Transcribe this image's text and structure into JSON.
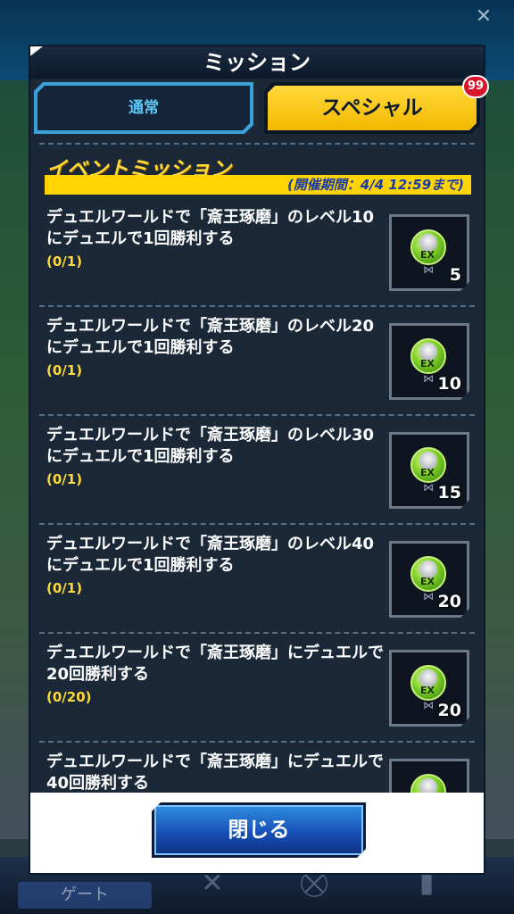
{
  "background": {
    "gate_label": "ゲート"
  },
  "modal": {
    "title": "ミッション",
    "tabs": [
      {
        "label": "通常",
        "active": false
      },
      {
        "label": "スペシャル",
        "active": true,
        "badge": "99"
      }
    ],
    "section_heading": "イベントミッション",
    "period": "(開催期間：4/4 12:59まで)",
    "missions": [
      {
        "title": "デュエルワールドで「斎王琢磨」のレベル10にデュエルで1回勝利する",
        "progress": "(0/1)",
        "reward_count": "5"
      },
      {
        "title": "デュエルワールドで「斎王琢磨」のレベル20にデュエルで1回勝利する",
        "progress": "(0/1)",
        "reward_count": "10"
      },
      {
        "title": "デュエルワールドで「斎王琢磨」のレベル30にデュエルで1回勝利する",
        "progress": "(0/1)",
        "reward_count": "15"
      },
      {
        "title": "デュエルワールドで「斎王琢磨」のレベル40にデュエルで1回勝利する",
        "progress": "(0/1)",
        "reward_count": "20"
      },
      {
        "title": "デュエルワールドで「斎王琢磨」にデュエルで20回勝利する",
        "progress": "(0/20)",
        "reward_count": "20"
      },
      {
        "title": "デュエルワールドで「斎王琢磨」にデュエルで40回勝利する",
        "progress": "",
        "reward_count": ""
      }
    ],
    "reward_icon_label": "EX",
    "close_label": "閉じる"
  },
  "colors": {
    "tab_active": "#f4b800",
    "tab_inactive_border": "#3aa0d8",
    "heading": "#ffd93a",
    "period_bar": "#ffd400",
    "badge": "#d8152a",
    "close_button": "#1850b8"
  }
}
